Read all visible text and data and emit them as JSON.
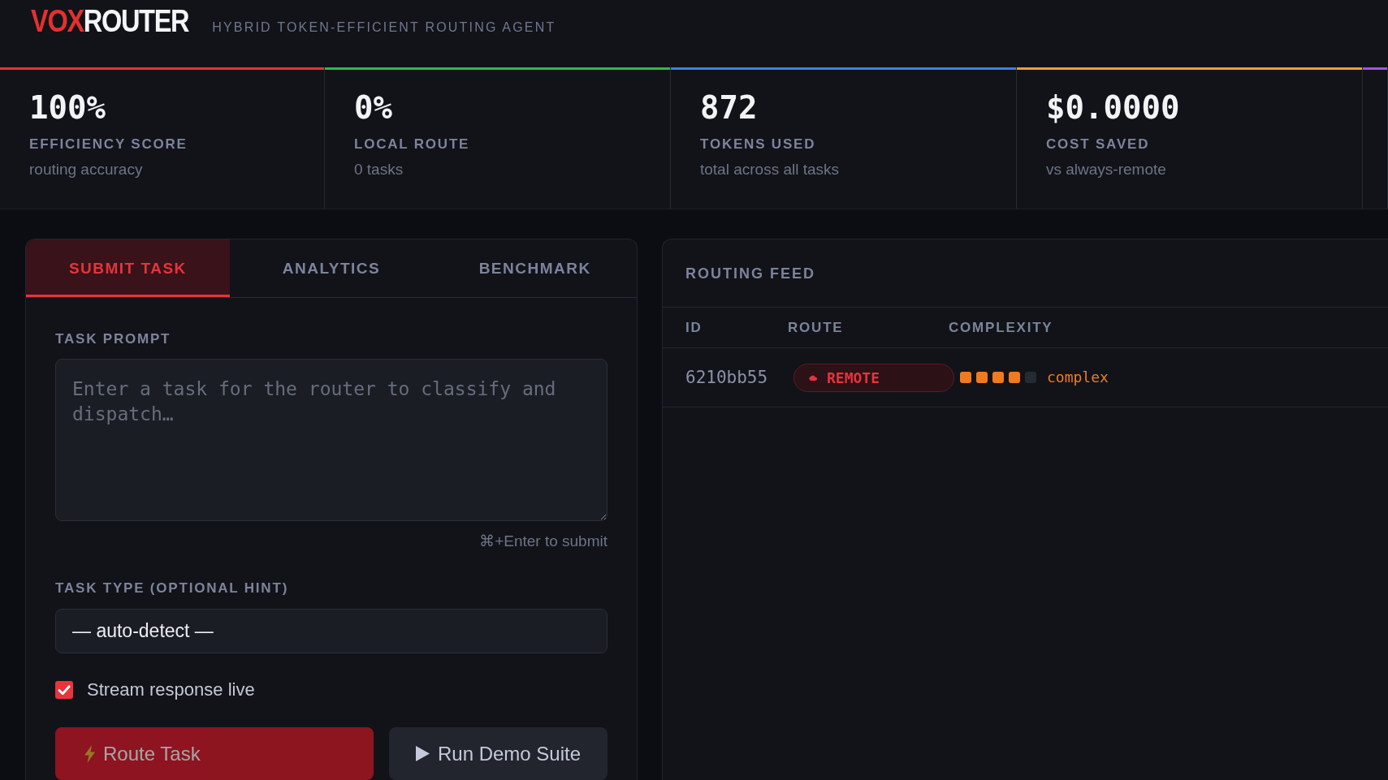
{
  "header": {
    "logo": {
      "accent": "VOX",
      "rest": "ROUTER"
    },
    "tagline": "HYBRID TOKEN-EFFICIENT ROUTING AGENT"
  },
  "stats": [
    {
      "value": "100%",
      "label": "EFFICIENCY SCORE",
      "caption": "routing accuracy",
      "color": "#e5342f"
    },
    {
      "value": "0%",
      "label": "LOCAL ROUTE",
      "caption": "0 tasks",
      "color": "#2eb84f"
    },
    {
      "value": "872",
      "label": "TOKENS USED",
      "caption": "total across all tasks",
      "color": "#3d7fe0"
    },
    {
      "value": "$0.0000",
      "label": "COST SAVED",
      "caption": "vs always-remote",
      "color": "#e9a030"
    },
    {
      "color": "#a452e0"
    }
  ],
  "task_panel": {
    "tabs": [
      {
        "label": "SUBMIT TASK",
        "selected": true
      },
      {
        "label": "ANALYTICS",
        "selected": false
      },
      {
        "label": "BENCHMARK",
        "selected": false
      }
    ],
    "prompt": {
      "label": "TASK PROMPT",
      "placeholder": "Enter a task for the router to classify and dispatch…",
      "hint": "⌘+Enter to submit"
    },
    "task_type": {
      "label": "TASK TYPE (OPTIONAL HINT)",
      "value": "— auto-detect —"
    },
    "stream": {
      "label": "Stream response live",
      "checked": true
    },
    "buttons": [
      {
        "label": "Route Task",
        "kind": "route",
        "disabled": true
      },
      {
        "label": "Run Demo Suite",
        "kind": "demo",
        "disabled": false
      }
    ]
  },
  "routing_feed": {
    "title": "ROUTING FEED",
    "columns": [
      "ID",
      "ROUTE",
      "COMPLEXITY"
    ],
    "rows": [
      {
        "id": "6210bb55",
        "route": "REMOTE",
        "complexity": {
          "stars": 4,
          "label": "complex"
        }
      }
    ]
  }
}
